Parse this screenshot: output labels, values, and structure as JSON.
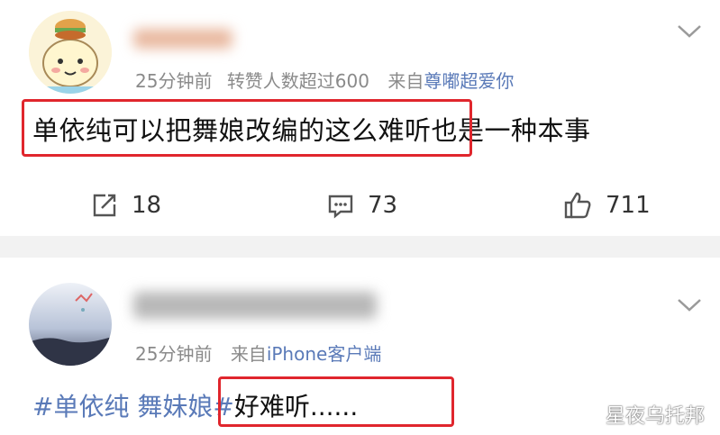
{
  "post1": {
    "meta_time": "25分钟前",
    "meta_note": "转赞人数超过600",
    "meta_from_label": "来自",
    "meta_source": "尊嘟超爱你",
    "content_highlight": "单依纯可以把舞娘改编的这么难听",
    "content_rest": "也是一种本事",
    "actions": {
      "repost_count": "18",
      "comment_count": "73",
      "like_count": "711"
    }
  },
  "post2": {
    "meta_time": "25分钟前",
    "meta_from_label": "来自",
    "meta_source": "iPhone客户端",
    "content_tag": "#单依纯 舞妹娘#",
    "content_text": "好难听......"
  },
  "watermark": "星夜乌托邦",
  "colors": {
    "link": "#5a7ab8",
    "highlight_box": "#e0262d",
    "separator": "#f2f2f2"
  }
}
